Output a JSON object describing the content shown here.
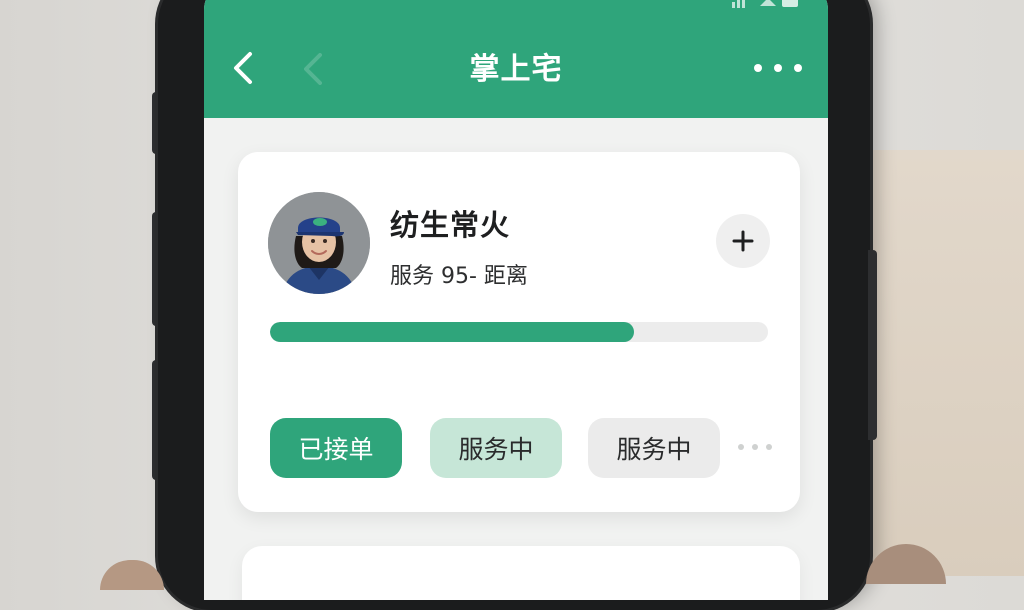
{
  "app": {
    "title": "掌上宅"
  },
  "colors": {
    "accent": "#2fa57b",
    "accent_light": "#c6e6d7",
    "chip_neutral": "#ebebeb"
  },
  "worker": {
    "name": "纺生常火",
    "meta": "服务 95- 距离",
    "avatar_icon": "worker-avatar"
  },
  "progress": {
    "fraction": 0.73
  },
  "chips": [
    {
      "label": "已接单",
      "state": "active"
    },
    {
      "label": "服务中",
      "state": "highlight"
    },
    {
      "label": "服务中",
      "state": "neutral"
    }
  ],
  "icons": {
    "back": "chevron-left-icon",
    "more": "more-dots-icon",
    "add": "plus-icon"
  }
}
